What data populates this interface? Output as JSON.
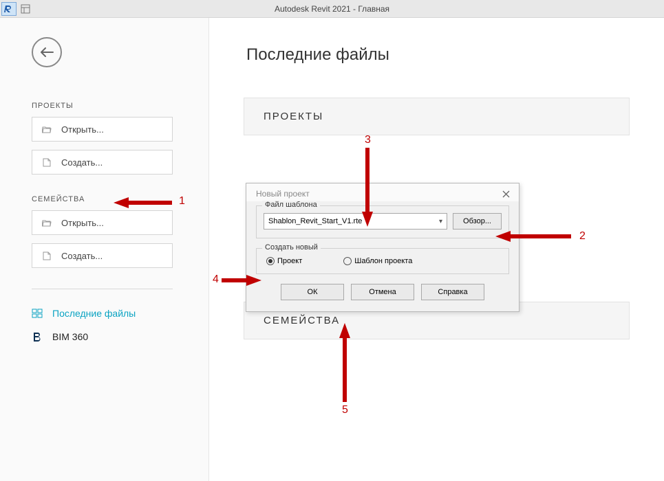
{
  "titlebar": {
    "title": "Autodesk Revit 2021 - Главная"
  },
  "sidebar": {
    "back_aria": "Назад",
    "projects_label": "ПРОЕКТЫ",
    "families_label": "СЕМЕЙСТВА",
    "open_label": "Открыть...",
    "create_label": "Создать...",
    "nav_recent": "Последние файлы",
    "nav_bim": "BIM 360"
  },
  "content": {
    "page_title": "Последние файлы",
    "panel_projects": "ПРОЕКТЫ",
    "panel_families": "СЕМЕЙСТВА"
  },
  "dialog": {
    "title": "Новый проект",
    "section_template": "Файл шаблона",
    "template_value": "Shablon_Revit_Start_V1.rte",
    "browse": "Обзор...",
    "section_create": "Создать новый",
    "opt_project": "Проект",
    "opt_template": "Шаблон проекта",
    "ok": "ОК",
    "cancel": "Отмена",
    "help": "Справка"
  },
  "annotations": {
    "n1": "1",
    "n2": "2",
    "n3": "3",
    "n4": "4",
    "n5": "5"
  }
}
